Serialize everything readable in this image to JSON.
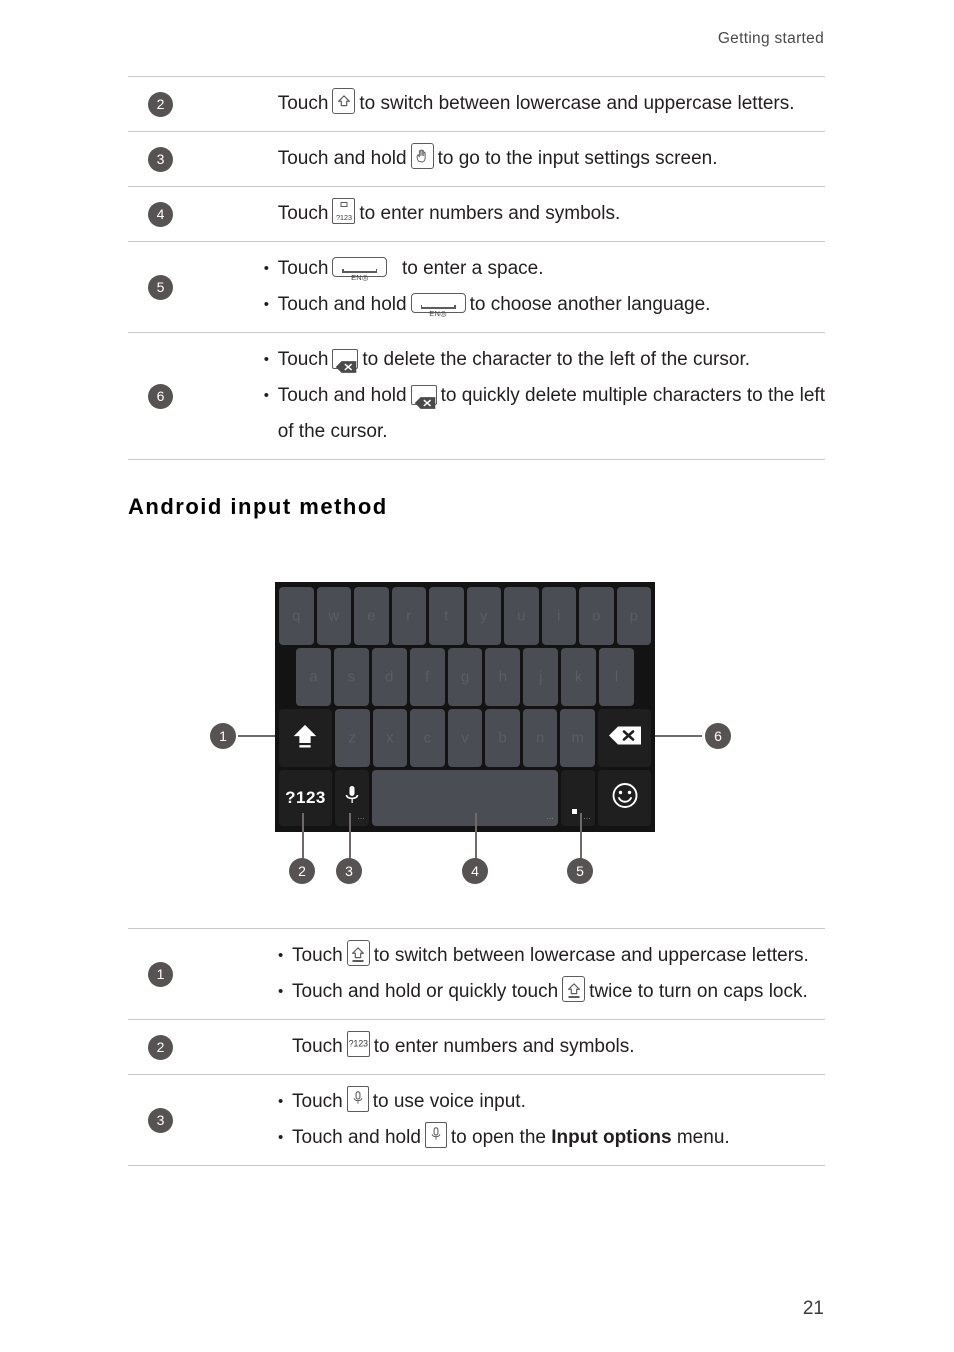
{
  "header": {
    "breadcrumb": "Getting started"
  },
  "footer": {
    "page_number": "21"
  },
  "section": {
    "title": "Android input method"
  },
  "top_table": {
    "rows": [
      {
        "number": "2",
        "lines": [
          {
            "bullet": false,
            "pre": "Touch",
            "icon": "shift-key-icon",
            "post": "to switch between lowercase and uppercase letters."
          }
        ]
      },
      {
        "number": "3",
        "lines": [
          {
            "bullet": false,
            "pre": "Touch and hold",
            "icon": "hand-key-icon",
            "post": "to go to the input settings screen."
          }
        ]
      },
      {
        "number": "4",
        "lines": [
          {
            "bullet": false,
            "pre": "Touch",
            "icon": "symbols-key-icon",
            "post": "to enter numbers and symbols."
          }
        ]
      },
      {
        "number": "5",
        "lines": [
          {
            "bullet": true,
            "pre": "Touch",
            "icon": "space-key-icon",
            "post": "to enter a space."
          },
          {
            "bullet": true,
            "pre": "Touch and hold",
            "icon": "space-key-icon",
            "post": "to choose another language."
          }
        ]
      },
      {
        "number": "6",
        "lines": [
          {
            "bullet": true,
            "pre": "Touch",
            "icon": "delete-key-icon",
            "post": "to delete the character to the left of the cursor."
          },
          {
            "bullet": true,
            "pre": "Touch and hold",
            "icon": "delete-key-icon",
            "post": "to quickly delete multiple characters to the left"
          },
          {
            "bullet": false,
            "continuation": true,
            "post": "of the cursor."
          }
        ]
      }
    ]
  },
  "bottom_table": {
    "rows": [
      {
        "number": "1",
        "lines": [
          {
            "bullet": true,
            "pre": "Touch",
            "icon": "shift-key-icon",
            "post": "to switch between lowercase and uppercase letters."
          },
          {
            "bullet": true,
            "pre": "Touch and hold or quickly touch",
            "icon": "shift-key-icon",
            "post": "twice to turn on caps lock."
          }
        ]
      },
      {
        "number": "2",
        "lines": [
          {
            "bullet": false,
            "pre": "Touch",
            "icon": "symbols-key-icon",
            "post": "to enter numbers and symbols."
          }
        ]
      },
      {
        "number": "3",
        "lines": [
          {
            "bullet": true,
            "pre": "Touch",
            "icon": "mic-key-icon",
            "post": "to use voice input."
          },
          {
            "bullet": true,
            "pre": "Touch and hold",
            "icon": "mic-key-icon",
            "post_a": "to open the ",
            "post_bold": "Input options",
            "post_b": " menu."
          }
        ]
      }
    ]
  },
  "keyboard_figure": {
    "keys": {
      "symbols_label": "?123",
      "row1_letters": [
        "q",
        "w",
        "e",
        "r",
        "t",
        "y",
        "u",
        "i",
        "o",
        "p"
      ],
      "row2_letters": [
        "a",
        "s",
        "d",
        "f",
        "g",
        "h",
        "j",
        "k",
        "l"
      ],
      "row3_letters": [
        "z",
        "x",
        "c",
        "v",
        "b",
        "n",
        "m"
      ],
      "shift": "shift-key",
      "delete": "delete-key",
      "mic": "microphone-key",
      "space": "space-key",
      "period": "period-key",
      "emoji": "emoji-key",
      "dots_hint": "…"
    },
    "callouts": [
      {
        "id": "1",
        "label": "1",
        "target": "shift-key"
      },
      {
        "id": "6",
        "label": "6",
        "target": "delete-key"
      },
      {
        "id": "2",
        "label": "2",
        "target": "symbols-key"
      },
      {
        "id": "3",
        "label": "3",
        "target": "microphone-key"
      },
      {
        "id": "4",
        "label": "4",
        "target": "space-key"
      },
      {
        "id": "5",
        "label": "5",
        "target": "period-key"
      }
    ]
  },
  "colors": {
    "badge_bg": "#575352",
    "keyboard_bg": "#131313",
    "key_light": "#4a4d54",
    "key_dark": "#1f1f1f",
    "rule": "#c8c8c8",
    "text": "#231f20"
  }
}
